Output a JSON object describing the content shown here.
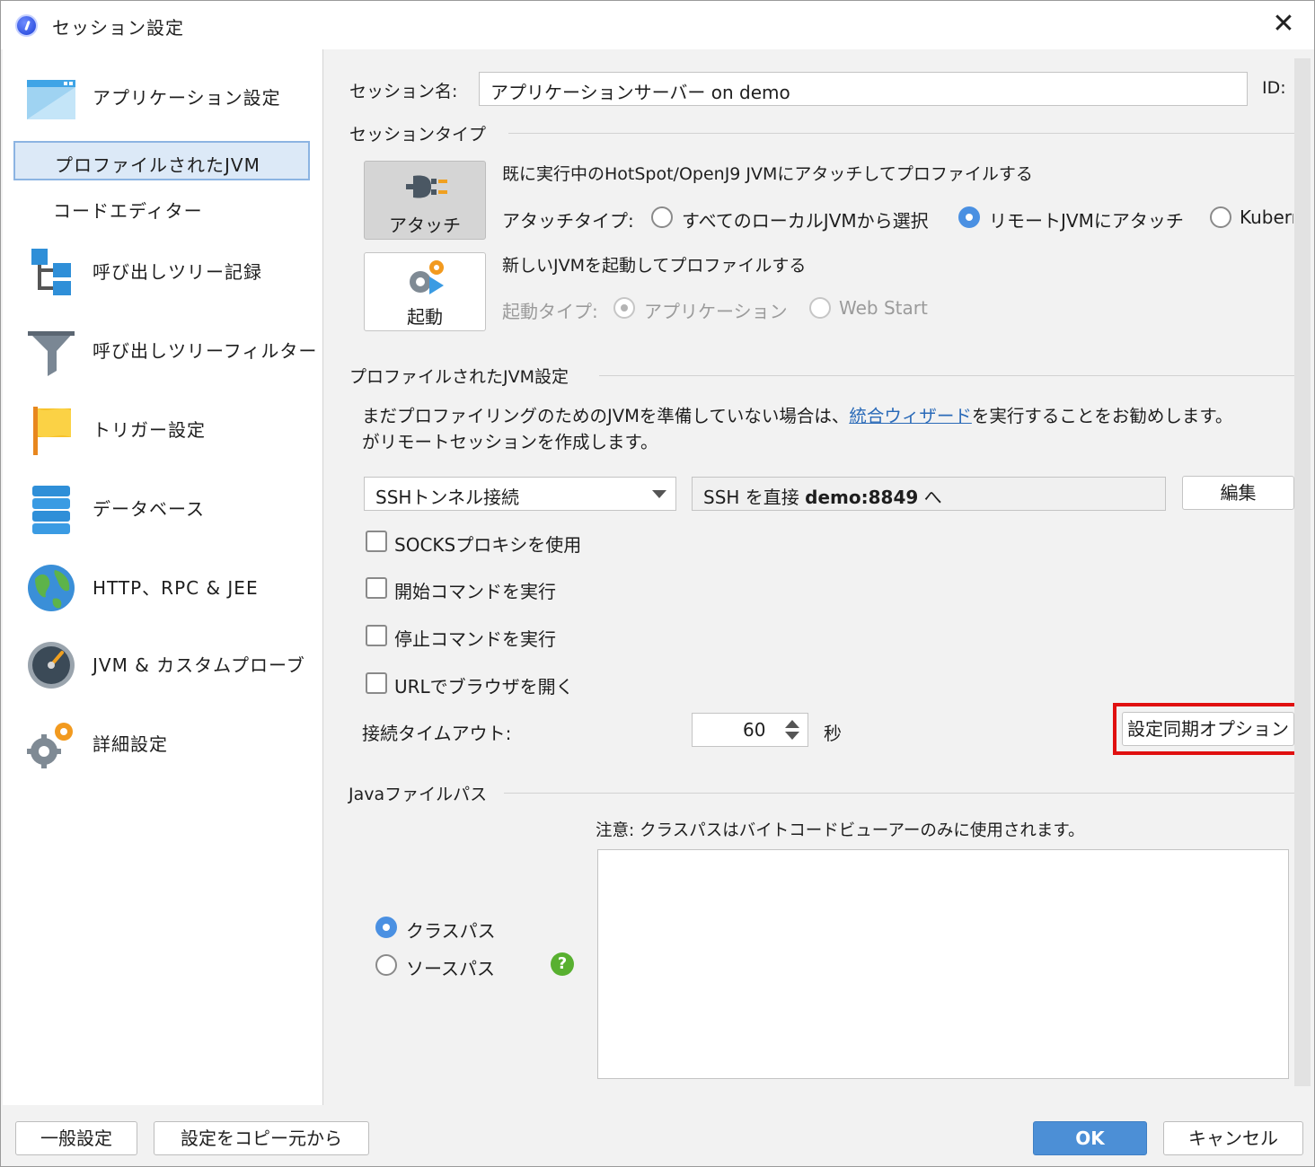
{
  "window": {
    "title": "セッション設定"
  },
  "sidebar": {
    "items": [
      {
        "label": "アプリケーション設定"
      },
      {
        "label": "プロファイルされたJVM"
      },
      {
        "label": "コードエディター"
      },
      {
        "label": "呼び出しツリー記録"
      },
      {
        "label": "呼び出しツリーフィルター"
      },
      {
        "label": "トリガー設定"
      },
      {
        "label": "データベース"
      },
      {
        "label": "HTTP、RPC & JEE"
      },
      {
        "label": "JVM & カスタムプローブ"
      },
      {
        "label": "詳細設定"
      }
    ]
  },
  "session": {
    "name_label": "セッション名:",
    "name_value": "アプリケーションサーバー on demo",
    "id_label": "ID:"
  },
  "session_type": {
    "section_title": "セッションタイプ",
    "attach_tile": "アタッチ",
    "attach_desc": "既に実行中のHotSpot/OpenJ9 JVMにアタッチしてプロファイルする",
    "attach_type_label": "アタッチタイプ:",
    "attach_options": [
      "すべてのローカルJVMから選択",
      "リモートJVMにアタッチ",
      "Kuberr"
    ],
    "launch_tile": "起動",
    "launch_desc": "新しいJVMを起動してプロファイルする",
    "launch_type_label": "起動タイプ:",
    "launch_options": [
      "アプリケーション",
      "Web Start"
    ]
  },
  "jvm_settings": {
    "section_title": "プロファイルされたJVM設定",
    "info_before": "まだプロファイリングのためのJVMを準備していない場合は、",
    "info_link": "統合ウィザード",
    "info_after": "を実行することをお勧めします。",
    "info_line2": "がリモートセッションを作成します。",
    "connection_type": "SSHトンネル接続",
    "ssh_prefix": "SSH を直接 ",
    "ssh_host": "demo:8849",
    "ssh_suffix": " へ",
    "edit_button": "編集",
    "checkboxes": [
      "SOCKSプロキシを使用",
      "開始コマンドを実行",
      "停止コマンドを実行",
      "URLでブラウザを開く"
    ],
    "timeout_label": "接続タイムアウト:",
    "timeout_value": "60",
    "timeout_unit": "秒",
    "sync_button": "設定同期オプション"
  },
  "java_paths": {
    "section_title": "Javaファイルパス",
    "note": "注意: クラスパスはバイトコードビューアーのみに使用されます。",
    "options": [
      "クラスパス",
      "ソースパス"
    ],
    "help_icon": "?"
  },
  "footer": {
    "general_button": "一般設定",
    "copy_button": "設定をコピー元から",
    "ok_button": "OK",
    "cancel_button": "キャンセル"
  }
}
